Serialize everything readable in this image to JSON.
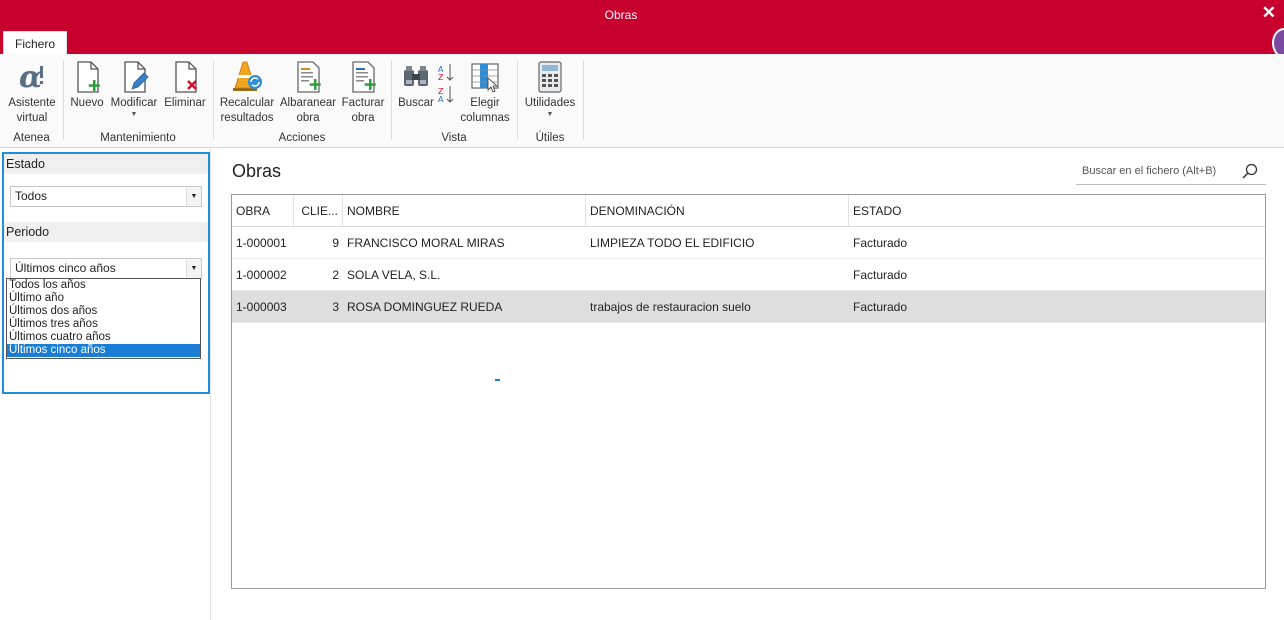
{
  "window": {
    "title": "Obras",
    "close_glyph": "✕"
  },
  "menu": {
    "tab": "Fichero"
  },
  "ribbon": {
    "groups": [
      {
        "label": "Atenea",
        "buttons": [
          {
            "line1": "Asistente",
            "line2": "virtual",
            "icon": "alpha-icon"
          }
        ]
      },
      {
        "label": "Mantenimiento",
        "buttons": [
          {
            "line1": "Nuevo",
            "icon": "new-document-icon"
          },
          {
            "line1": "Modificar",
            "icon": "edit-document-icon",
            "has_caret": true
          },
          {
            "line1": "Eliminar",
            "icon": "delete-document-icon"
          }
        ]
      },
      {
        "label": "Acciones",
        "buttons": [
          {
            "line1": "Recalcular",
            "line2": "resultados",
            "icon": "recalculate-icon"
          },
          {
            "line1": "Albaranear",
            "line2": "obra",
            "icon": "delivery-note-icon"
          },
          {
            "line1": "Facturar",
            "line2": "obra",
            "icon": "invoice-icon"
          }
        ]
      },
      {
        "label": "Vista",
        "buttons": [
          {
            "line1": "Buscar",
            "icon": "binoculars-icon"
          },
          {
            "line1": "",
            "icon": "sort-icon"
          },
          {
            "line1": "Elegir",
            "line2": "columnas",
            "icon": "choose-columns-icon"
          }
        ]
      },
      {
        "label": "Útiles",
        "buttons": [
          {
            "line1": "Utilidades",
            "icon": "calculator-icon",
            "has_caret": true
          }
        ]
      }
    ]
  },
  "filters": {
    "estado": {
      "label": "Estado",
      "value": "Todos"
    },
    "periodo": {
      "label": "Periodo",
      "value": "Últimos cinco años",
      "options": [
        "Todos los años",
        "Último año",
        "Últimos dos años",
        "Últimos tres años",
        "Últimos cuatro años",
        "Últimos cinco años"
      ],
      "selected_index": 5
    }
  },
  "main": {
    "title": "Obras",
    "search_placeholder": "Buscar en el fichero (Alt+B)",
    "columns": [
      "OBRA",
      "CLIE...",
      "NOMBRE",
      "DENOMINACIÓN",
      "ESTADO"
    ],
    "rows": [
      {
        "obra": "1-000001",
        "cliente": "9",
        "nombre": "FRANCISCO MORAL MIRAS",
        "denominacion": "LIMPIEZA TODO EL EDIFICIO",
        "estado": "Facturado"
      },
      {
        "obra": "1-000002",
        "cliente": "2",
        "nombre": "SOLA VELA, S.L.",
        "denominacion": "",
        "estado": "Facturado"
      },
      {
        "obra": "1-000003",
        "cliente": "3",
        "nombre": "ROSA DOMINGUEZ RUEDA",
        "denominacion": "trabajos de restauracion suelo",
        "estado": "Facturado",
        "selected": true
      }
    ]
  },
  "colors": {
    "titlebar": "#c8002e",
    "accent_blue": "#1e8fd6",
    "selection": "#1a7ed6",
    "row_selected": "#dedede"
  }
}
